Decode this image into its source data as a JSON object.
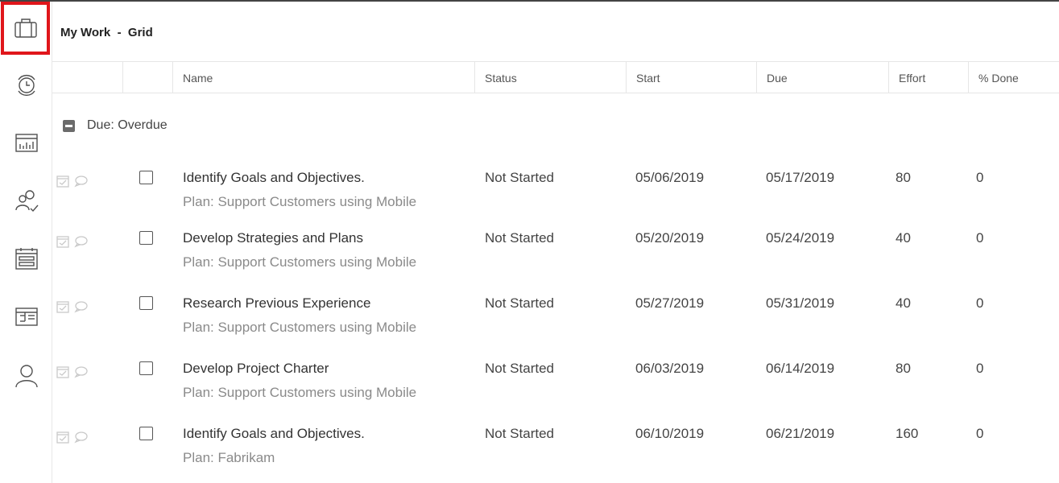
{
  "header": {
    "title": "My Work  -  Grid"
  },
  "sidebar": {
    "items": [
      {
        "name": "my-work",
        "icon": "briefcase-icon",
        "selected": true
      },
      {
        "name": "my-time",
        "icon": "clock-icon",
        "selected": false
      },
      {
        "name": "reports",
        "icon": "chart-icon",
        "selected": false
      },
      {
        "name": "resources",
        "icon": "people-check-icon",
        "selected": false
      },
      {
        "name": "calendar",
        "icon": "calendar-icon",
        "selected": false
      },
      {
        "name": "roadmap",
        "icon": "roadmap-icon",
        "selected": false
      },
      {
        "name": "profile",
        "icon": "person-icon",
        "selected": false
      }
    ],
    "selected_border_color": "#e0161b"
  },
  "grid": {
    "columns": [
      "",
      "",
      "Name",
      "Status",
      "Start",
      "Due",
      "Effort",
      "% Done"
    ],
    "group": {
      "label": "Due: Overdue",
      "expanded": true
    },
    "rows": [
      {
        "name": "Identify Goals and Objectives.",
        "plan": "Plan: Support Customers using Mobile",
        "status": "Not Started",
        "start": "05/06/2019",
        "due": "05/17/2019",
        "effort": "80",
        "done": "0",
        "checked": false
      },
      {
        "name": "Develop Strategies and Plans",
        "plan": "Plan: Support Customers using Mobile",
        "status": "Not Started",
        "start": "05/20/2019",
        "due": "05/24/2019",
        "effort": "40",
        "done": "0",
        "checked": false
      },
      {
        "name": "Research Previous Experience",
        "plan": "Plan: Support Customers using Mobile",
        "status": "Not Started",
        "start": "05/27/2019",
        "due": "05/31/2019",
        "effort": "40",
        "done": "0",
        "checked": false
      },
      {
        "name": "Develop Project Charter",
        "plan": "Plan: Support Customers using Mobile",
        "status": "Not Started",
        "start": "06/03/2019",
        "due": "06/14/2019",
        "effort": "80",
        "done": "0",
        "checked": false
      },
      {
        "name": "Identify Goals and Objectives.",
        "plan": "Plan: Fabrikam",
        "status": "Not Started",
        "start": "06/10/2019",
        "due": "06/21/2019",
        "effort": "160",
        "done": "0",
        "checked": false
      }
    ]
  }
}
